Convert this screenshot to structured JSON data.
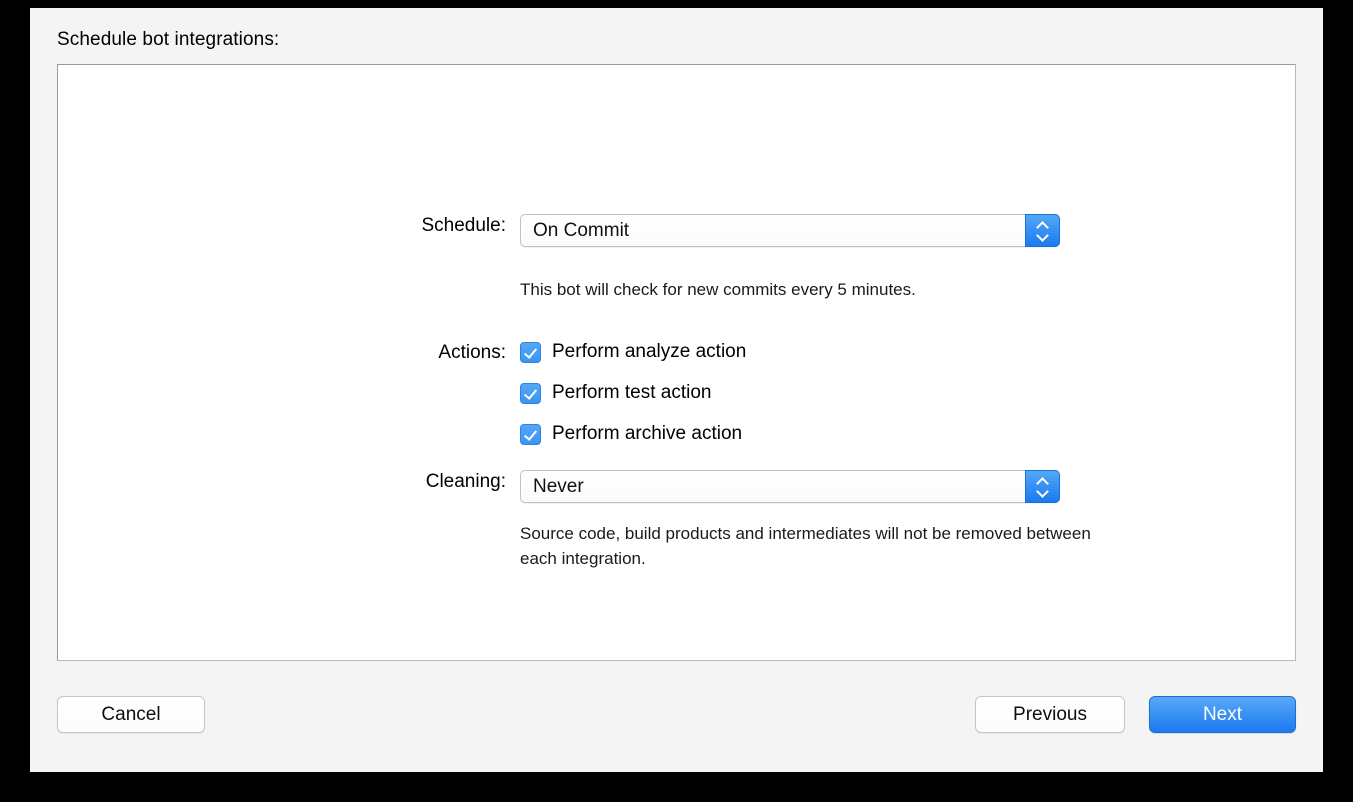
{
  "header": {
    "title": "Schedule bot integrations:"
  },
  "form": {
    "schedule": {
      "label": "Schedule:",
      "value": "On Commit",
      "stepper_up_icon": "chevron-up-icon",
      "stepper_down_icon": "chevron-down-icon",
      "hint": "This bot will check for new commits every 5 minutes."
    },
    "actions": {
      "label": "Actions:",
      "items": [
        {
          "label": "Perform analyze action",
          "checked": true
        },
        {
          "label": "Perform test action",
          "checked": true
        },
        {
          "label": "Perform archive action",
          "checked": true
        }
      ]
    },
    "cleaning": {
      "label": "Cleaning:",
      "value": "Never",
      "stepper_up_icon": "chevron-up-icon",
      "stepper_down_icon": "chevron-down-icon",
      "hint": "Source code, build products and intermediates will not be removed between each integration."
    }
  },
  "footer": {
    "cancel_label": "Cancel",
    "previous_label": "Previous",
    "next_label": "Next"
  },
  "colors": {
    "accent_blue": "#1a7af0",
    "accent_blue_light": "#5aa9f7",
    "window_bg": "#f4f4f4",
    "panel_bg": "#ffffff",
    "panel_border": "#9a9a9a"
  }
}
